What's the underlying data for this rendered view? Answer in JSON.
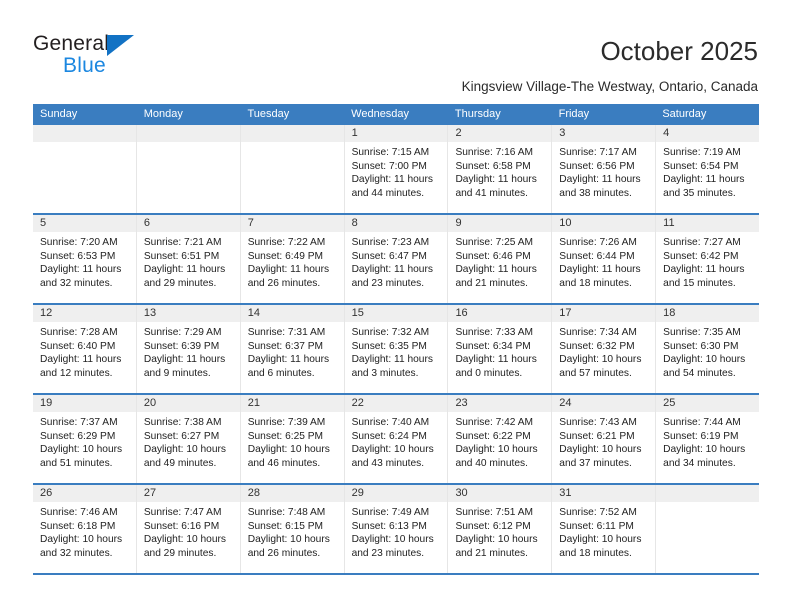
{
  "brand": {
    "name_top": "General",
    "name_bottom": "Blue"
  },
  "header": {
    "title": "October 2025",
    "subtitle": "Kingsview Village-The Westway, Ontario, Canada"
  },
  "colors": {
    "header_blue": "#3a7dc0",
    "daynum_band": "#efefef",
    "logo_blue": "#1b87e0",
    "logo_dark": "#231f20"
  },
  "calendar": {
    "weekdays": [
      "Sunday",
      "Monday",
      "Tuesday",
      "Wednesday",
      "Thursday",
      "Friday",
      "Saturday"
    ],
    "weeks": [
      [
        {
          "day": "",
          "sunrise": "",
          "sunset": "",
          "daylight": ""
        },
        {
          "day": "",
          "sunrise": "",
          "sunset": "",
          "daylight": ""
        },
        {
          "day": "",
          "sunrise": "",
          "sunset": "",
          "daylight": ""
        },
        {
          "day": "1",
          "sunrise": "Sunrise: 7:15 AM",
          "sunset": "Sunset: 7:00 PM",
          "daylight": "Daylight: 11 hours and 44 minutes."
        },
        {
          "day": "2",
          "sunrise": "Sunrise: 7:16 AM",
          "sunset": "Sunset: 6:58 PM",
          "daylight": "Daylight: 11 hours and 41 minutes."
        },
        {
          "day": "3",
          "sunrise": "Sunrise: 7:17 AM",
          "sunset": "Sunset: 6:56 PM",
          "daylight": "Daylight: 11 hours and 38 minutes."
        },
        {
          "day": "4",
          "sunrise": "Sunrise: 7:19 AM",
          "sunset": "Sunset: 6:54 PM",
          "daylight": "Daylight: 11 hours and 35 minutes."
        }
      ],
      [
        {
          "day": "5",
          "sunrise": "Sunrise: 7:20 AM",
          "sunset": "Sunset: 6:53 PM",
          "daylight": "Daylight: 11 hours and 32 minutes."
        },
        {
          "day": "6",
          "sunrise": "Sunrise: 7:21 AM",
          "sunset": "Sunset: 6:51 PM",
          "daylight": "Daylight: 11 hours and 29 minutes."
        },
        {
          "day": "7",
          "sunrise": "Sunrise: 7:22 AM",
          "sunset": "Sunset: 6:49 PM",
          "daylight": "Daylight: 11 hours and 26 minutes."
        },
        {
          "day": "8",
          "sunrise": "Sunrise: 7:23 AM",
          "sunset": "Sunset: 6:47 PM",
          "daylight": "Daylight: 11 hours and 23 minutes."
        },
        {
          "day": "9",
          "sunrise": "Sunrise: 7:25 AM",
          "sunset": "Sunset: 6:46 PM",
          "daylight": "Daylight: 11 hours and 21 minutes."
        },
        {
          "day": "10",
          "sunrise": "Sunrise: 7:26 AM",
          "sunset": "Sunset: 6:44 PM",
          "daylight": "Daylight: 11 hours and 18 minutes."
        },
        {
          "day": "11",
          "sunrise": "Sunrise: 7:27 AM",
          "sunset": "Sunset: 6:42 PM",
          "daylight": "Daylight: 11 hours and 15 minutes."
        }
      ],
      [
        {
          "day": "12",
          "sunrise": "Sunrise: 7:28 AM",
          "sunset": "Sunset: 6:40 PM",
          "daylight": "Daylight: 11 hours and 12 minutes."
        },
        {
          "day": "13",
          "sunrise": "Sunrise: 7:29 AM",
          "sunset": "Sunset: 6:39 PM",
          "daylight": "Daylight: 11 hours and 9 minutes."
        },
        {
          "day": "14",
          "sunrise": "Sunrise: 7:31 AM",
          "sunset": "Sunset: 6:37 PM",
          "daylight": "Daylight: 11 hours and 6 minutes."
        },
        {
          "day": "15",
          "sunrise": "Sunrise: 7:32 AM",
          "sunset": "Sunset: 6:35 PM",
          "daylight": "Daylight: 11 hours and 3 minutes."
        },
        {
          "day": "16",
          "sunrise": "Sunrise: 7:33 AM",
          "sunset": "Sunset: 6:34 PM",
          "daylight": "Daylight: 11 hours and 0 minutes."
        },
        {
          "day": "17",
          "sunrise": "Sunrise: 7:34 AM",
          "sunset": "Sunset: 6:32 PM",
          "daylight": "Daylight: 10 hours and 57 minutes."
        },
        {
          "day": "18",
          "sunrise": "Sunrise: 7:35 AM",
          "sunset": "Sunset: 6:30 PM",
          "daylight": "Daylight: 10 hours and 54 minutes."
        }
      ],
      [
        {
          "day": "19",
          "sunrise": "Sunrise: 7:37 AM",
          "sunset": "Sunset: 6:29 PM",
          "daylight": "Daylight: 10 hours and 51 minutes."
        },
        {
          "day": "20",
          "sunrise": "Sunrise: 7:38 AM",
          "sunset": "Sunset: 6:27 PM",
          "daylight": "Daylight: 10 hours and 49 minutes."
        },
        {
          "day": "21",
          "sunrise": "Sunrise: 7:39 AM",
          "sunset": "Sunset: 6:25 PM",
          "daylight": "Daylight: 10 hours and 46 minutes."
        },
        {
          "day": "22",
          "sunrise": "Sunrise: 7:40 AM",
          "sunset": "Sunset: 6:24 PM",
          "daylight": "Daylight: 10 hours and 43 minutes."
        },
        {
          "day": "23",
          "sunrise": "Sunrise: 7:42 AM",
          "sunset": "Sunset: 6:22 PM",
          "daylight": "Daylight: 10 hours and 40 minutes."
        },
        {
          "day": "24",
          "sunrise": "Sunrise: 7:43 AM",
          "sunset": "Sunset: 6:21 PM",
          "daylight": "Daylight: 10 hours and 37 minutes."
        },
        {
          "day": "25",
          "sunrise": "Sunrise: 7:44 AM",
          "sunset": "Sunset: 6:19 PM",
          "daylight": "Daylight: 10 hours and 34 minutes."
        }
      ],
      [
        {
          "day": "26",
          "sunrise": "Sunrise: 7:46 AM",
          "sunset": "Sunset: 6:18 PM",
          "daylight": "Daylight: 10 hours and 32 minutes."
        },
        {
          "day": "27",
          "sunrise": "Sunrise: 7:47 AM",
          "sunset": "Sunset: 6:16 PM",
          "daylight": "Daylight: 10 hours and 29 minutes."
        },
        {
          "day": "28",
          "sunrise": "Sunrise: 7:48 AM",
          "sunset": "Sunset: 6:15 PM",
          "daylight": "Daylight: 10 hours and 26 minutes."
        },
        {
          "day": "29",
          "sunrise": "Sunrise: 7:49 AM",
          "sunset": "Sunset: 6:13 PM",
          "daylight": "Daylight: 10 hours and 23 minutes."
        },
        {
          "day": "30",
          "sunrise": "Sunrise: 7:51 AM",
          "sunset": "Sunset: 6:12 PM",
          "daylight": "Daylight: 10 hours and 21 minutes."
        },
        {
          "day": "31",
          "sunrise": "Sunrise: 7:52 AM",
          "sunset": "Sunset: 6:11 PM",
          "daylight": "Daylight: 10 hours and 18 minutes."
        },
        {
          "day": "",
          "sunrise": "",
          "sunset": "",
          "daylight": ""
        }
      ]
    ]
  }
}
